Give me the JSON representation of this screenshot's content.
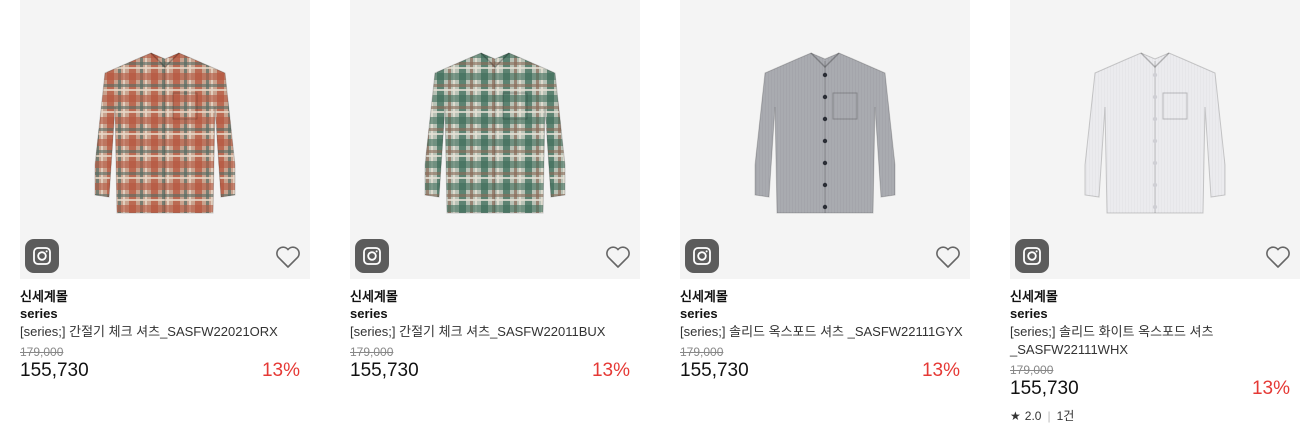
{
  "products": [
    {
      "brand": "신세계몰",
      "sub_brand": "series",
      "name": "[series;] 간절기 체크 셔츠_SASFW22021ORX",
      "original_price": "179,000",
      "price": "155,730",
      "discount": "13%",
      "colors": {
        "base": "#c9a38f",
        "line1": "#b5573f",
        "line2": "#566c64",
        "line3": "#e8d8c8"
      }
    },
    {
      "brand": "신세계몰",
      "sub_brand": "series",
      "name": "[series;] 간절기 체크 셔츠_SASFW22011BUX",
      "original_price": "179,000",
      "price": "155,730",
      "discount": "13%",
      "colors": {
        "base": "#b9c2b6",
        "line1": "#3f6e5b",
        "line2": "#8a6a58",
        "line3": "#e6e1d6"
      }
    },
    {
      "brand": "신세계몰",
      "sub_brand": "series",
      "name": "[series;] 솔리드 옥스포드 셔츠 _SASFW22111GYX",
      "original_price": "179,000",
      "price": "155,730",
      "discount": "13%",
      "colors": {
        "base": "#a9abb0",
        "line1": "#9a9ca2",
        "line2": "#2a2d35",
        "line3": "#b6b8bd"
      }
    },
    {
      "brand": "신세계몰",
      "sub_brand": "series",
      "name": "[series;] 솔리드 화이트 옥스포드 셔츠 _SASFW22111WHX",
      "original_price": "179,000",
      "price": "155,730",
      "discount": "13%",
      "rating": {
        "star": "★",
        "score": "2.0",
        "reviews": "1건"
      },
      "colors": {
        "base": "#ebebee",
        "line1": "#dcdce0",
        "line2": "#cfcfd4",
        "line3": "#f4f4f6"
      }
    }
  ],
  "icons": {
    "insta": "instagram-icon",
    "like": "heart-icon"
  }
}
